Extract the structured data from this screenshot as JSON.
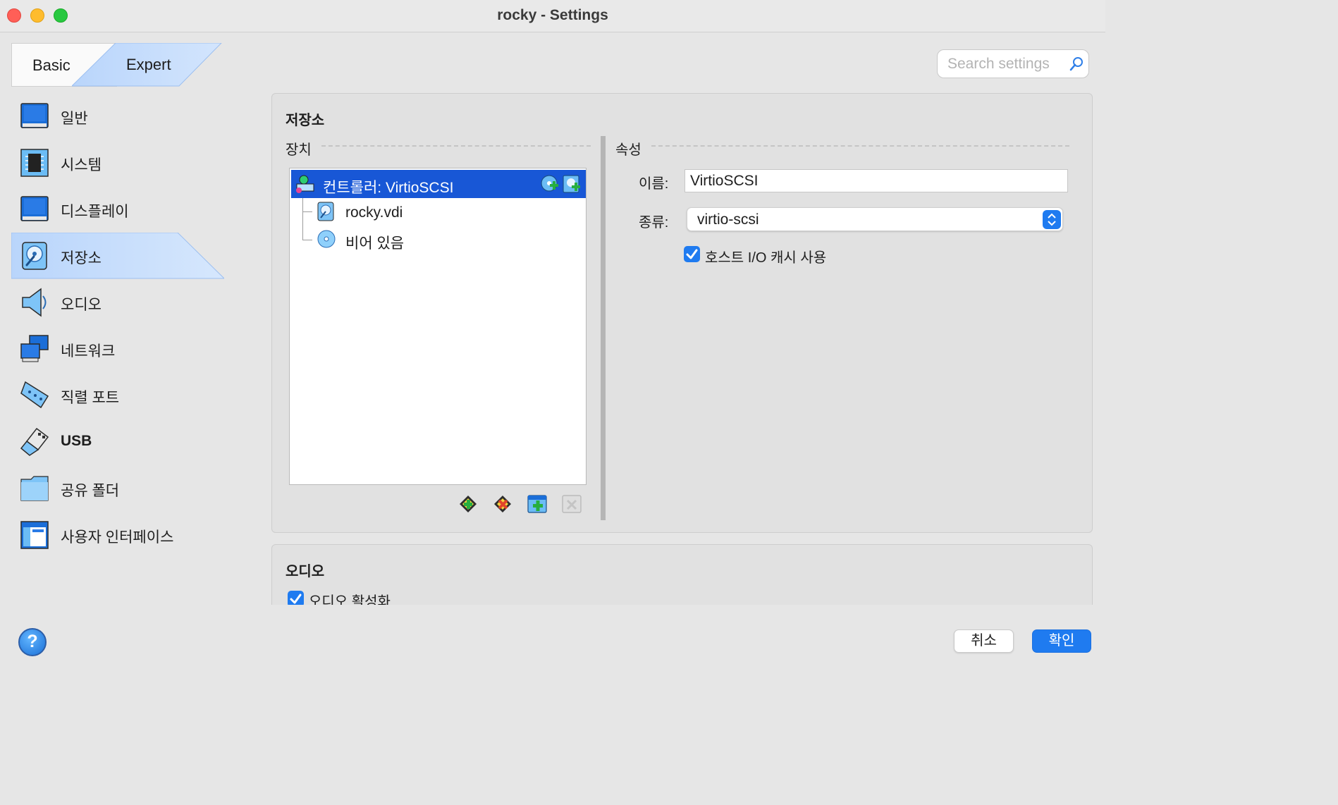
{
  "window": {
    "title": "rocky - Settings"
  },
  "modes": {
    "basic": "Basic",
    "expert": "Expert"
  },
  "search": {
    "placeholder": "Search settings"
  },
  "sidebar": {
    "items": [
      {
        "label": "일반",
        "icon": "general-icon"
      },
      {
        "label": "시스템",
        "icon": "system-chip-icon"
      },
      {
        "label": "디스플레이",
        "icon": "display-monitor-icon"
      },
      {
        "label": "저장소",
        "icon": "storage-disk-icon",
        "active": true
      },
      {
        "label": "오디오",
        "icon": "audio-speaker-icon"
      },
      {
        "label": "네트워크",
        "icon": "network-icon"
      },
      {
        "label": "직렬 포트",
        "icon": "serial-port-icon"
      },
      {
        "label": "USB",
        "icon": "usb-icon"
      },
      {
        "label": "공유 폴더",
        "icon": "shared-folder-icon"
      },
      {
        "label": "사용자 인터페이스",
        "icon": "user-interface-icon"
      }
    ]
  },
  "storage": {
    "title": "저장소",
    "devices_label": "장치",
    "properties_label": "속성",
    "tree": {
      "controller": "컨트롤러: VirtioSCSI",
      "children": [
        "rocky.vdi",
        "비어 있음"
      ]
    },
    "properties": {
      "name_label": "이름:",
      "name_value": "VirtioSCSI",
      "type_label": "종류:",
      "type_value": "virtio-scsi",
      "host_cache_label": "호스트 I/O 캐시 사용",
      "host_cache_checked": true
    }
  },
  "audio": {
    "title": "오디오",
    "enable_label": "오디오 활성화",
    "enabled": true
  },
  "buttons": {
    "cancel": "취소",
    "ok": "확인",
    "help": "?"
  },
  "colors": {
    "accent": "#1f7bf0",
    "selection": "#1857d6",
    "active_tab": "#c4dcff"
  }
}
